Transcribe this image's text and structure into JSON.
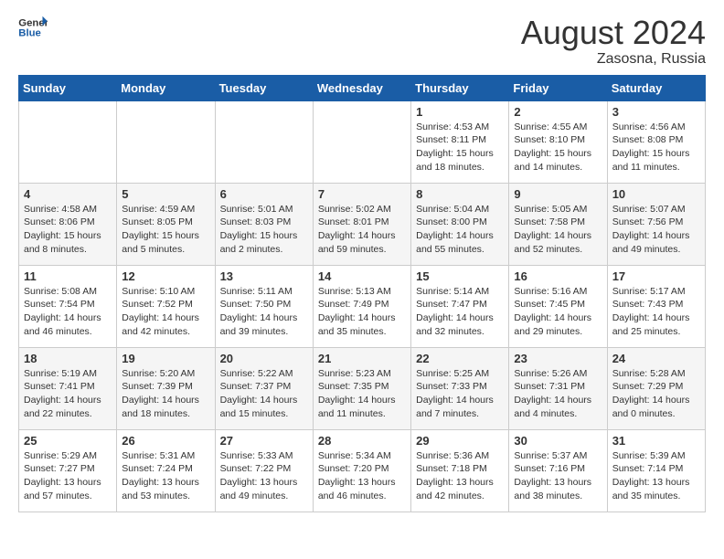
{
  "logo": {
    "line1": "General",
    "line2": "Blue"
  },
  "title": "August 2024",
  "subtitle": "Zasosna, Russia",
  "weekdays": [
    "Sunday",
    "Monday",
    "Tuesday",
    "Wednesday",
    "Thursday",
    "Friday",
    "Saturday"
  ],
  "weeks": [
    [
      {
        "day": "",
        "info": ""
      },
      {
        "day": "",
        "info": ""
      },
      {
        "day": "",
        "info": ""
      },
      {
        "day": "",
        "info": ""
      },
      {
        "day": "1",
        "info": "Sunrise: 4:53 AM\nSunset: 8:11 PM\nDaylight: 15 hours\nand 18 minutes."
      },
      {
        "day": "2",
        "info": "Sunrise: 4:55 AM\nSunset: 8:10 PM\nDaylight: 15 hours\nand 14 minutes."
      },
      {
        "day": "3",
        "info": "Sunrise: 4:56 AM\nSunset: 8:08 PM\nDaylight: 15 hours\nand 11 minutes."
      }
    ],
    [
      {
        "day": "4",
        "info": "Sunrise: 4:58 AM\nSunset: 8:06 PM\nDaylight: 15 hours\nand 8 minutes."
      },
      {
        "day": "5",
        "info": "Sunrise: 4:59 AM\nSunset: 8:05 PM\nDaylight: 15 hours\nand 5 minutes."
      },
      {
        "day": "6",
        "info": "Sunrise: 5:01 AM\nSunset: 8:03 PM\nDaylight: 15 hours\nand 2 minutes."
      },
      {
        "day": "7",
        "info": "Sunrise: 5:02 AM\nSunset: 8:01 PM\nDaylight: 14 hours\nand 59 minutes."
      },
      {
        "day": "8",
        "info": "Sunrise: 5:04 AM\nSunset: 8:00 PM\nDaylight: 14 hours\nand 55 minutes."
      },
      {
        "day": "9",
        "info": "Sunrise: 5:05 AM\nSunset: 7:58 PM\nDaylight: 14 hours\nand 52 minutes."
      },
      {
        "day": "10",
        "info": "Sunrise: 5:07 AM\nSunset: 7:56 PM\nDaylight: 14 hours\nand 49 minutes."
      }
    ],
    [
      {
        "day": "11",
        "info": "Sunrise: 5:08 AM\nSunset: 7:54 PM\nDaylight: 14 hours\nand 46 minutes."
      },
      {
        "day": "12",
        "info": "Sunrise: 5:10 AM\nSunset: 7:52 PM\nDaylight: 14 hours\nand 42 minutes."
      },
      {
        "day": "13",
        "info": "Sunrise: 5:11 AM\nSunset: 7:50 PM\nDaylight: 14 hours\nand 39 minutes."
      },
      {
        "day": "14",
        "info": "Sunrise: 5:13 AM\nSunset: 7:49 PM\nDaylight: 14 hours\nand 35 minutes."
      },
      {
        "day": "15",
        "info": "Sunrise: 5:14 AM\nSunset: 7:47 PM\nDaylight: 14 hours\nand 32 minutes."
      },
      {
        "day": "16",
        "info": "Sunrise: 5:16 AM\nSunset: 7:45 PM\nDaylight: 14 hours\nand 29 minutes."
      },
      {
        "day": "17",
        "info": "Sunrise: 5:17 AM\nSunset: 7:43 PM\nDaylight: 14 hours\nand 25 minutes."
      }
    ],
    [
      {
        "day": "18",
        "info": "Sunrise: 5:19 AM\nSunset: 7:41 PM\nDaylight: 14 hours\nand 22 minutes."
      },
      {
        "day": "19",
        "info": "Sunrise: 5:20 AM\nSunset: 7:39 PM\nDaylight: 14 hours\nand 18 minutes."
      },
      {
        "day": "20",
        "info": "Sunrise: 5:22 AM\nSunset: 7:37 PM\nDaylight: 14 hours\nand 15 minutes."
      },
      {
        "day": "21",
        "info": "Sunrise: 5:23 AM\nSunset: 7:35 PM\nDaylight: 14 hours\nand 11 minutes."
      },
      {
        "day": "22",
        "info": "Sunrise: 5:25 AM\nSunset: 7:33 PM\nDaylight: 14 hours\nand 7 minutes."
      },
      {
        "day": "23",
        "info": "Sunrise: 5:26 AM\nSunset: 7:31 PM\nDaylight: 14 hours\nand 4 minutes."
      },
      {
        "day": "24",
        "info": "Sunrise: 5:28 AM\nSunset: 7:29 PM\nDaylight: 14 hours\nand 0 minutes."
      }
    ],
    [
      {
        "day": "25",
        "info": "Sunrise: 5:29 AM\nSunset: 7:27 PM\nDaylight: 13 hours\nand 57 minutes."
      },
      {
        "day": "26",
        "info": "Sunrise: 5:31 AM\nSunset: 7:24 PM\nDaylight: 13 hours\nand 53 minutes."
      },
      {
        "day": "27",
        "info": "Sunrise: 5:33 AM\nSunset: 7:22 PM\nDaylight: 13 hours\nand 49 minutes."
      },
      {
        "day": "28",
        "info": "Sunrise: 5:34 AM\nSunset: 7:20 PM\nDaylight: 13 hours\nand 46 minutes."
      },
      {
        "day": "29",
        "info": "Sunrise: 5:36 AM\nSunset: 7:18 PM\nDaylight: 13 hours\nand 42 minutes."
      },
      {
        "day": "30",
        "info": "Sunrise: 5:37 AM\nSunset: 7:16 PM\nDaylight: 13 hours\nand 38 minutes."
      },
      {
        "day": "31",
        "info": "Sunrise: 5:39 AM\nSunset: 7:14 PM\nDaylight: 13 hours\nand 35 minutes."
      }
    ]
  ]
}
